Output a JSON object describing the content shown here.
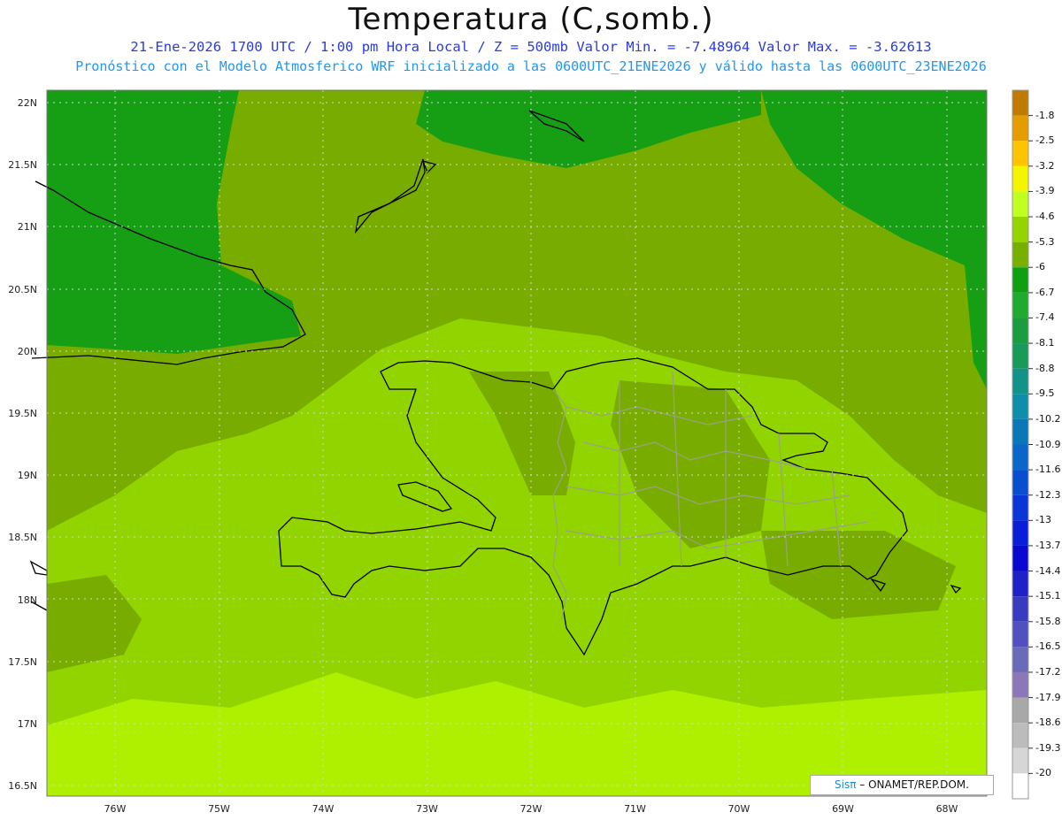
{
  "title": "Temperatura (C,somb.)",
  "subtitle_line1": "21-Ene-2026  1700 UTC / 1:00 pm Hora Local / Z = 500mb  Valor Min. = -7.48964  Valor Max. = -3.62613",
  "subtitle_line2": "Pronóstico con el Modelo Atmosferico WRF inicializado a las 0600UTC_21ENE2026 y válido hasta las  0600UTC_23ENE2026",
  "lat_labels": [
    "22N",
    "21.5N",
    "21N",
    "20.5N",
    "20N",
    "19.5N",
    "19N",
    "18.5N",
    "18N",
    "17.5N",
    "17N",
    "16.5N"
  ],
  "lon_labels": [
    "76W",
    "75W",
    "74W",
    "73W",
    "72W",
    "71W",
    "70W",
    "69W",
    "68W"
  ],
  "colorbar": {
    "labels": [
      "-1.8",
      "-2.5",
      "-3.2",
      "-3.9",
      "-4.6",
      "-5.3",
      "-6",
      "-6.7",
      "-7.4",
      "-8.1",
      "-8.8",
      "-9.5",
      "-10.2",
      "-10.9",
      "-11.6",
      "-12.3",
      "-13",
      "-13.7",
      "-14.4",
      "-15.1",
      "-15.8",
      "-16.5",
      "-17.2",
      "-17.9",
      "-18.6",
      "-19.3",
      "-20"
    ],
    "colors": [
      "#c07a00",
      "#e59c00",
      "#ffc400",
      "#f5f500",
      "#c0ff20",
      "#96d400",
      "#78b000",
      "#0ea010",
      "#20aa30",
      "#1b9c3e",
      "#189a58",
      "#11938a",
      "#0e8ea8",
      "#0a78b8",
      "#0a66c8",
      "#0a4ed0",
      "#0a36d8",
      "#081ed8",
      "#0a08d0",
      "#2020c8",
      "#3a3ac0",
      "#5050c0",
      "#6a6ab8",
      "#8a78b8",
      "#a8a8a8",
      "#bcbcbc",
      "#d6d6d6",
      "#ffffff"
    ]
  },
  "credit": {
    "sis": "Sisπ",
    "org": " – ONAMET/REP.DOM."
  },
  "field_colors": {
    "dark": "#169e14",
    "mid": "#78ad00",
    "light": "#92d400",
    "lighter": "#aef000"
  }
}
